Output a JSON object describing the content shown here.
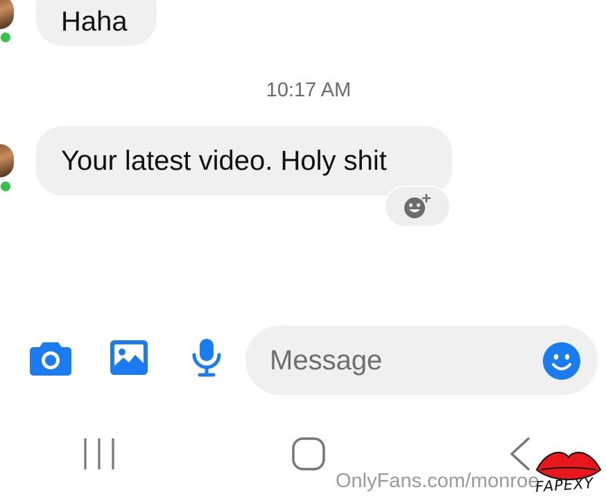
{
  "conversation": {
    "messages": [
      {
        "sender": "contact",
        "text": "Haha"
      },
      {
        "sender": "contact",
        "text": "Your latest video. Holy shit"
      }
    ],
    "timestamp": "10:17 AM",
    "reaction_icon": "add-reaction-icon",
    "contact_status": "online"
  },
  "composer": {
    "placeholder": "Message",
    "tools": [
      "camera-icon",
      "gallery-icon",
      "microphone-icon"
    ],
    "emoji_icon": "emoji-icon"
  },
  "system_nav": {
    "items": [
      "recent-apps-icon",
      "home-icon",
      "back-icon"
    ]
  },
  "overlay": {
    "watermark": "OnlyFans.com/monroe",
    "brand_text": "FAPEXY"
  },
  "colors": {
    "accent": "#1a7cf0",
    "bubble": "#f0f0f0",
    "online": "#35c24a",
    "brand_red": "#e8171c"
  }
}
